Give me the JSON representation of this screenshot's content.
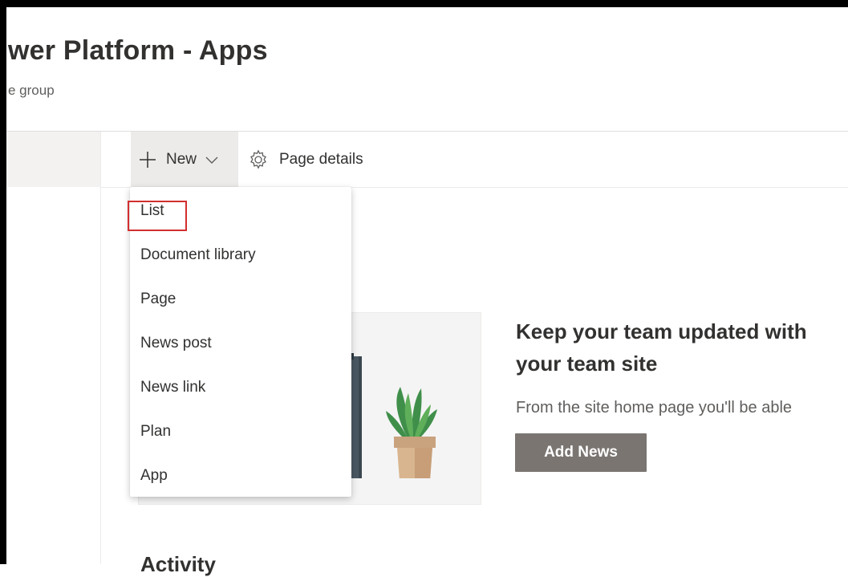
{
  "header": {
    "site_title": "wer Platform - Apps",
    "site_subtitle": "e group"
  },
  "command_bar": {
    "new_label": "New",
    "page_details_label": "Page details"
  },
  "new_menu": {
    "items": [
      {
        "label": "List",
        "highlighted": true
      },
      {
        "label": "Document library"
      },
      {
        "label": "Page"
      },
      {
        "label": "News post"
      },
      {
        "label": "News link"
      },
      {
        "label": "Plan"
      },
      {
        "label": "App"
      }
    ]
  },
  "news": {
    "heading_line1": "Keep your team updated with",
    "heading_line2": "your team site",
    "description": "From the site home page you'll be able",
    "add_button": "Add News"
  },
  "activity": {
    "heading": "Activity"
  },
  "colors": {
    "accent_box": "#d32f2f",
    "add_news_bg": "#7a7571",
    "hover_bg": "#edebe9"
  }
}
